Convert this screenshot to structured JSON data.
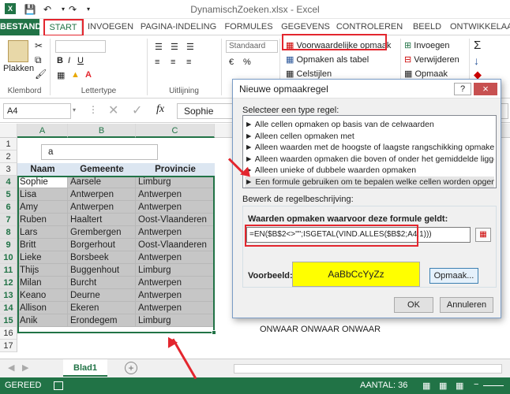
{
  "window": {
    "title": "DynamischZoeken.xlsx - Excel"
  },
  "tabs": [
    {
      "label": "BESTAND"
    },
    {
      "label": "START"
    },
    {
      "label": "INVOEGEN"
    },
    {
      "label": "PAGINA-INDELING"
    },
    {
      "label": "FORMULES"
    },
    {
      "label": "GEGEVENS"
    },
    {
      "label": "CONTROLEREN"
    },
    {
      "label": "BEELD"
    },
    {
      "label": "ONTWIKKELAAR"
    }
  ],
  "ribbon": {
    "paste_label": "Plakken",
    "groups": {
      "clipboard": "Klembord",
      "font": "Lettertype",
      "alignment": "Uitlijning"
    },
    "number_format": "Standaard",
    "conditional_formatting": "Voorwaardelijke opmaak",
    "format_as_table": "Opmaken als tabel",
    "cell_styles": "Celstijlen",
    "insert": "Invoegen",
    "delete": "Verwijderen",
    "format": "Opmaak"
  },
  "formula_bar": {
    "name_box": "A4",
    "content": "Sophie",
    "fx": "fx"
  },
  "sheet": {
    "columns": [
      "A",
      "B",
      "C"
    ],
    "row_numbers": [
      "1",
      "2",
      "3",
      "4",
      "5",
      "6",
      "7",
      "8",
      "9",
      "10",
      "11",
      "12",
      "13",
      "14",
      "15",
      "16",
      "17"
    ],
    "search_value": "a",
    "headers": [
      "Naam",
      "Gemeente",
      "Provincie"
    ],
    "rows": [
      [
        "Sophie",
        "Aarsele",
        "Limburg"
      ],
      [
        "Lisa",
        "Antwerpen",
        "Antwerpen"
      ],
      [
        "Amy",
        "Antwerpen",
        "Antwerpen"
      ],
      [
        "Ruben",
        "Haaltert",
        "Oost-Vlaanderen"
      ],
      [
        "Lars",
        "Grembergen",
        "Antwerpen"
      ],
      [
        "Britt",
        "Borgerhout",
        "Oost-Vlaanderen"
      ],
      [
        "Lieke",
        "Borsbeek",
        "Antwerpen"
      ],
      [
        "Thijs",
        "Buggenhout",
        "Limburg"
      ],
      [
        "Milan",
        "Burcht",
        "Antwerpen"
      ],
      [
        "Keano",
        "Deurne",
        "Antwerpen"
      ],
      [
        "Allison",
        "Ekeren",
        "Antwerpen"
      ],
      [
        "Anik",
        "Erondegem",
        "Limburg"
      ]
    ],
    "onwaar": [
      "ONWAAR",
      "ONWAAR",
      "ONWAAR"
    ],
    "sheet_tab": "Blad1",
    "add_sheet": "+"
  },
  "status": {
    "ready": "GEREED",
    "count": "AANTAL: 36"
  },
  "dialog": {
    "title": "Nieuwe opmaakregel",
    "help": "?",
    "close": "×",
    "select_rule_label": "Selecteer een type regel:",
    "rule_types": [
      "Alle cellen opmaken op basis van de celwaarden",
      "Alleen cellen opmaken met",
      "Alleen waarden met de hoogste of laagste rangschikking opmaken",
      "Alleen waarden opmaken die boven of onder het gemiddelde liggen",
      "Alleen unieke of dubbele waarden opmaken",
      "Een formule gebruiken om te bepalen welke cellen worden opgemaakt"
    ],
    "edit_label": "Bewerk de regelbeschrijving:",
    "formula_label": "Waarden opmaken waarvoor deze formule geldt:",
    "formula": "=EN($B$2<>\"\";ISGETAL(VIND.ALLES($B$2;A4;1)))",
    "preview_label": "Voorbeeld:",
    "preview_text": "AaBbCcYyZz",
    "format_button": "Opmaak...",
    "ok": "OK",
    "cancel": "Annuleren"
  },
  "colors": {
    "excel_green": "#217346",
    "highlight": "#ffff00",
    "annotation_red": "#e3262e",
    "selection": "#c6c6c6"
  }
}
